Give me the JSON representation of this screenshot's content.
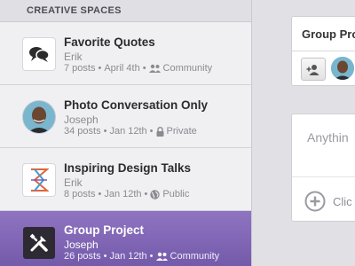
{
  "sidebar": {
    "header": "CREATIVE SPACES",
    "spaces": [
      {
        "title": "Favorite Quotes",
        "owner": "Erik",
        "posts": "7 posts",
        "date": "April 4th",
        "visibility": "Community",
        "visibility_icon": "community-icon",
        "thumb_icon": "speech-bubbles-icon",
        "active": false
      },
      {
        "title": "Photo Conversation Only",
        "owner": "Joseph",
        "posts": "34 posts",
        "date": "Jan 12th",
        "visibility": "Private",
        "visibility_icon": "lock-icon",
        "thumb_icon": "avatar",
        "active": false
      },
      {
        "title": "Inspiring Design Talks",
        "owner": "Erik",
        "posts": "8 posts",
        "date": "Jan 12th",
        "visibility": "Public",
        "visibility_icon": "globe-icon",
        "thumb_icon": "logo-mark",
        "active": false
      },
      {
        "title": "Group Project",
        "owner": "Joseph",
        "posts": "26 posts",
        "date": "Jan 12th",
        "visibility": "Community",
        "visibility_icon": "community-icon",
        "thumb_icon": "tools-icon",
        "active": true
      }
    ],
    "separator": "•"
  },
  "card": {
    "title": "Group Pro",
    "add_member_icon": "add-member-icon"
  },
  "compose": {
    "placeholder": "Anythin",
    "attach_label": "Clic",
    "attach_icon": "plus-circle-icon"
  },
  "colors": {
    "active_gradient_top": "#8f74c1",
    "active_gradient_bottom": "#7158a8",
    "sidebar_bg": "#ececee",
    "page_bg": "#e1e1e5"
  }
}
